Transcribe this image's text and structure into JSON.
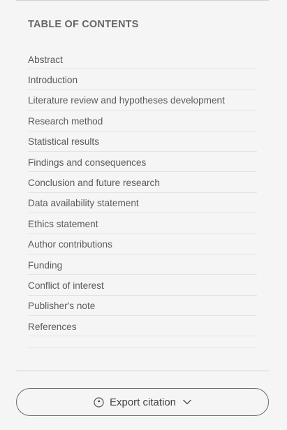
{
  "toc": {
    "title": "TABLE OF CONTENTS",
    "items": [
      "Abstract",
      "Introduction",
      "Literature review and hypotheses development",
      "Research method",
      "Statistical results",
      "Findings and consequences",
      "Conclusion and future research",
      "Data availability statement",
      "Ethics statement",
      "Author contributions",
      "Funding",
      "Conflict of interest",
      "Publisher's note",
      "References"
    ]
  },
  "export": {
    "label": "Export citation",
    "icon": "citation-icon",
    "caret_icon": "chevron-down-icon"
  }
}
